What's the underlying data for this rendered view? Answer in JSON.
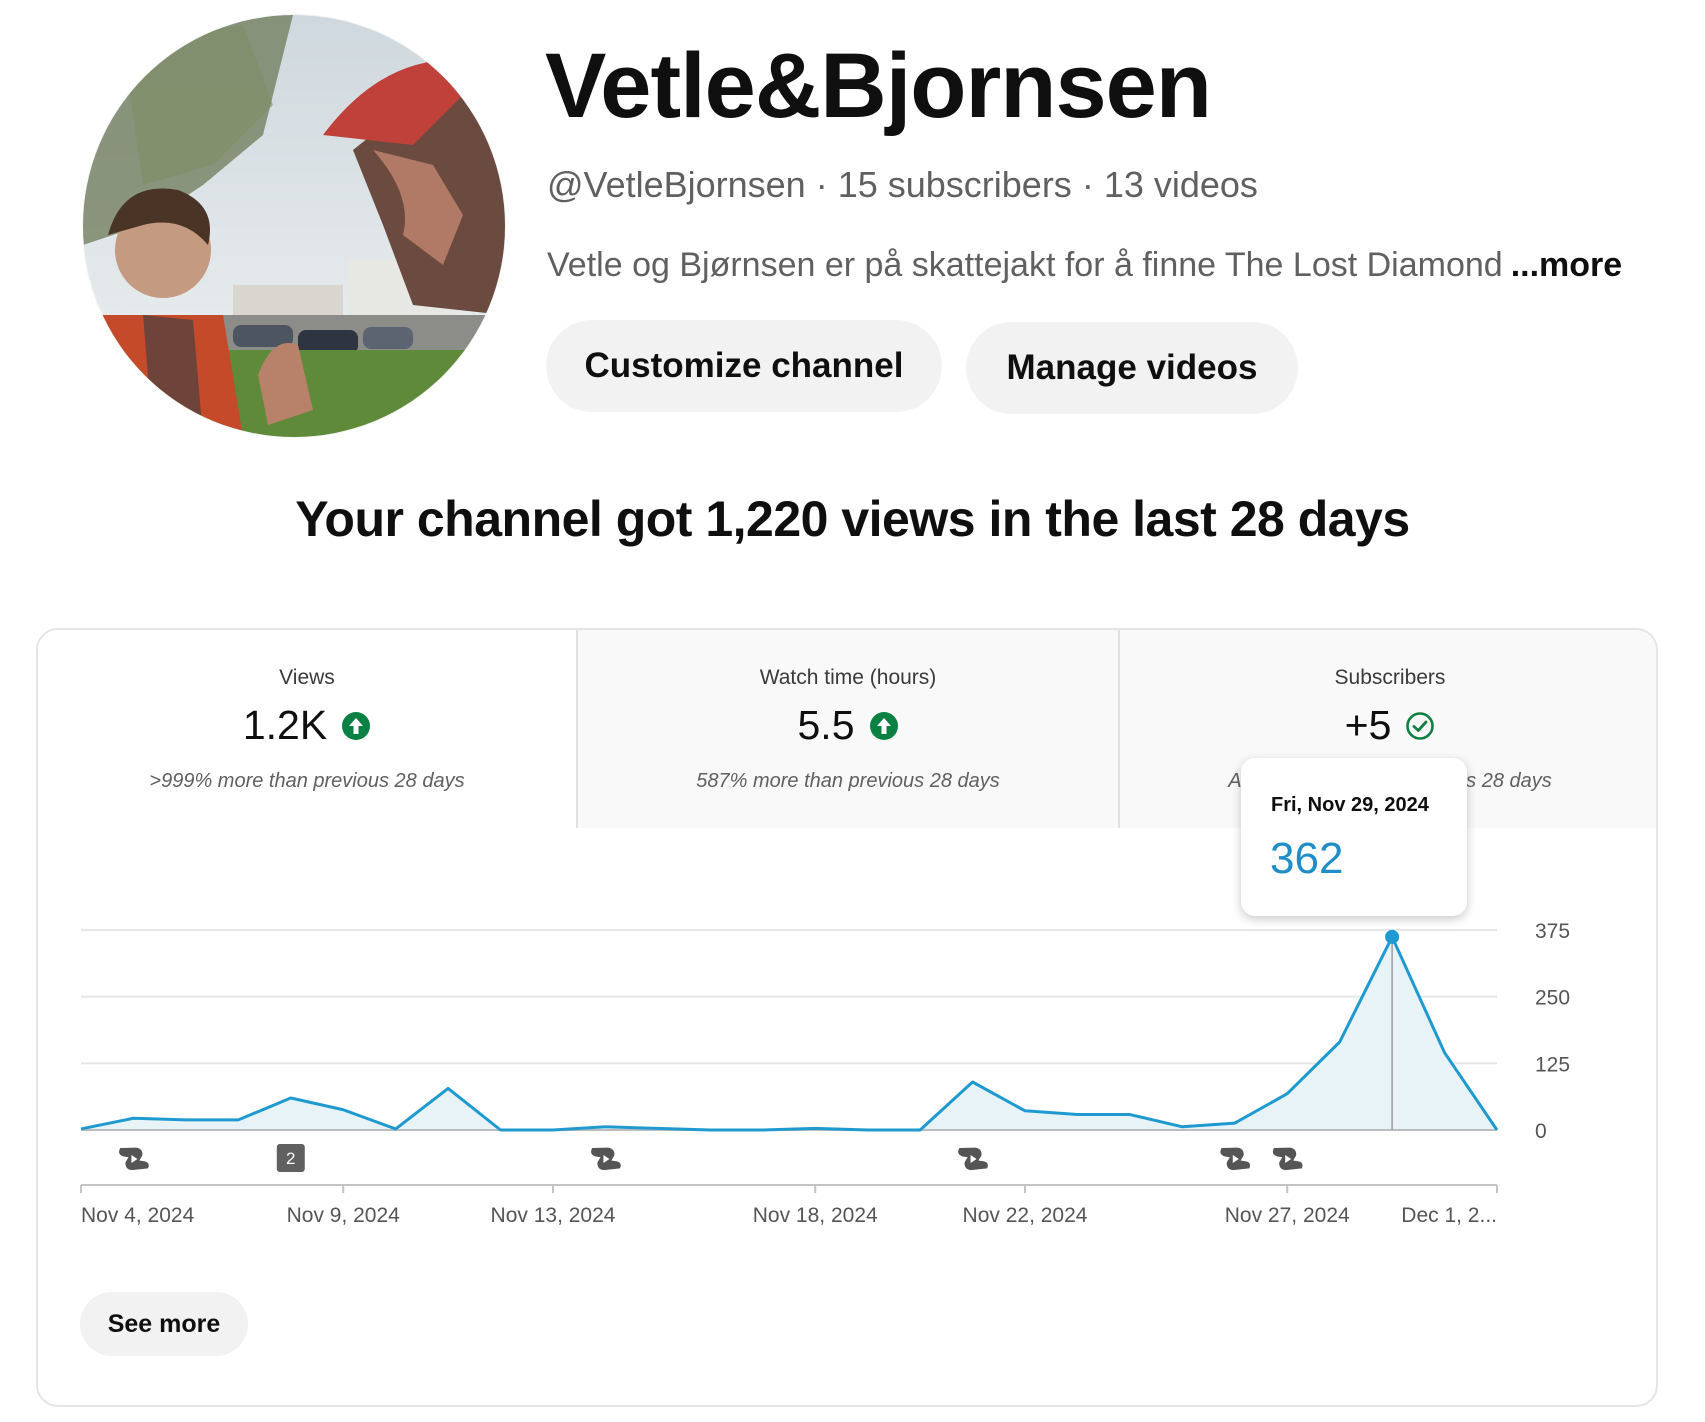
{
  "channel": {
    "name": "Vetle&Bjornsen",
    "handle": "@VetleBjornsen",
    "separator": "·",
    "subscribers": "15 subscribers",
    "videos": "13 videos",
    "description": "Vetle og Bjørnsen er på skattejakt for å finne The Lost Diamond",
    "more_label": "...more"
  },
  "buttons": {
    "customize": "Customize channel",
    "manage": "Manage videos",
    "see_more": "See more"
  },
  "headline": "Your channel got 1,220 views in the last 28 days",
  "metrics": [
    {
      "label": "Views",
      "value": "1.2K",
      "note": ">999% more than previous 28 days",
      "indicator": "arrow-up-icon",
      "indicator_color": "#0b8043"
    },
    {
      "label": "Watch time (hours)",
      "value": "5.5",
      "note": "587% more than previous 28 days",
      "indicator": "arrow-up-icon",
      "indicator_color": "#0b8043"
    },
    {
      "label": "Subscribers",
      "value": "+5",
      "note": "About the same as previous 28 days",
      "indicator": "check-circle-icon",
      "indicator_color": "#0b8043"
    }
  ],
  "tooltip": {
    "date": "Fri, Nov 29, 2024",
    "value": "362"
  },
  "chart_data": {
    "type": "area",
    "series": [
      {
        "values": [
          2,
          22,
          19,
          19,
          60,
          38,
          2,
          78,
          0,
          0,
          6,
          3,
          0,
          0,
          3,
          0,
          0,
          90,
          36,
          29,
          29,
          6,
          13,
          68,
          165,
          362,
          145,
          0
        ]
      }
    ],
    "x_start": "Nov 4, 2024",
    "x_end": "Dec 1, 2024",
    "x_tick_labels": [
      "Nov 4, 2024",
      "Nov 9, 2024",
      "Nov 13, 2024",
      "Nov 18, 2024",
      "Nov 22, 2024",
      "Nov 27, 2024",
      "Dec 1, 2..."
    ],
    "y_ticks": [
      "0",
      "125",
      "250",
      "375"
    ],
    "ylim": [
      0,
      375
    ],
    "highlight": {
      "date": "Fri, Nov 29, 2024",
      "value": 362
    },
    "upload_markers": [
      {
        "date": "Nov 5, 2024",
        "icon": "shorts-icon"
      },
      {
        "date": "Nov 8, 2024",
        "icon": "count-badge",
        "label": "2"
      },
      {
        "date": "Nov 14, 2024",
        "icon": "shorts-icon"
      },
      {
        "date": "Nov 21, 2024",
        "icon": "shorts-icon"
      },
      {
        "date": "Nov 26, 2024",
        "icon": "shorts-icon"
      },
      {
        "date": "Nov 27, 2024",
        "icon": "shorts-icon"
      }
    ],
    "line_color": "#1f9ad0",
    "fill_color": "#e8f3f8",
    "grid": true
  }
}
